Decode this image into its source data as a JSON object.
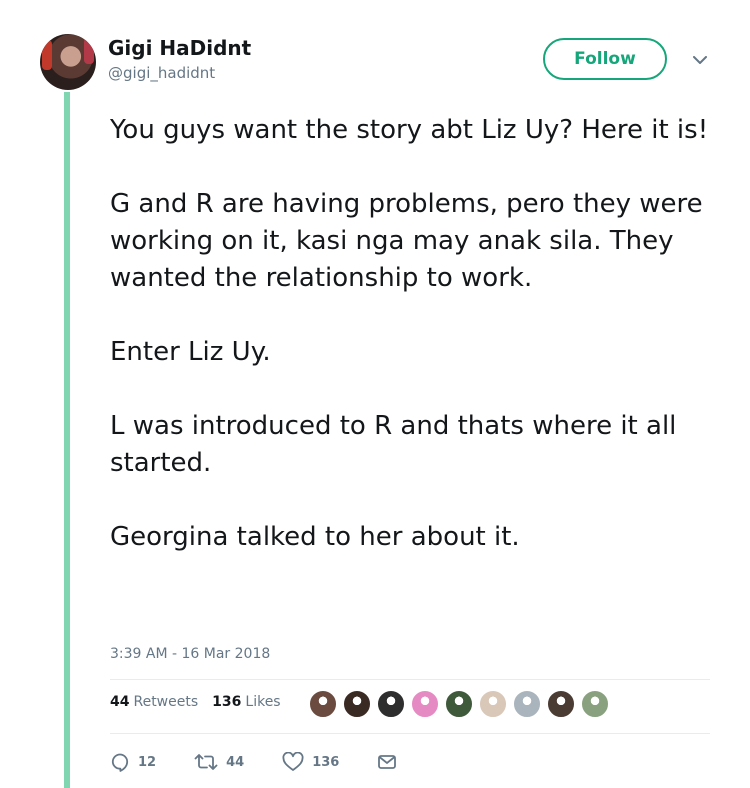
{
  "author": {
    "display_name": "Gigi HaDidnt",
    "handle": "@gigi_hadidnt",
    "avatar": "avatar-photo"
  },
  "follow_button": {
    "label": "Follow",
    "color": "#16a67a"
  },
  "menu": {
    "icon": "chevron-down-icon"
  },
  "tweet": {
    "paragraphs": [
      "You guys want the story abt Liz Uy? Here it is!",
      "G and R are having problems, pero they were working on it, kasi nga may anak sila. They wanted the relationship to work.",
      "Enter Liz Uy.",
      "L was introduced to R and thats where it all started.",
      "Georgina talked to her about it."
    ],
    "timestamp": "3:39 AM - 16 Mar 2018"
  },
  "stats": {
    "retweets_count": "44",
    "retweets_label": "Retweets",
    "likes_count": "136",
    "likes_label": "Likes"
  },
  "likers": [
    {
      "color": "#6b4a3f"
    },
    {
      "color": "#3a2a24"
    },
    {
      "color": "#2e2e2e"
    },
    {
      "color": "#e58ac2"
    },
    {
      "color": "#3f5a3a"
    },
    {
      "color": "#d9c7b8"
    },
    {
      "color": "#a9b4bd"
    },
    {
      "color": "#4a3b33"
    },
    {
      "color": "#8aa17f"
    }
  ],
  "actions": {
    "reply_count": "12",
    "retweet_count": "44",
    "like_count": "136"
  },
  "colors": {
    "thread_line": "#7fd6b1",
    "text": "#14171a",
    "muted": "#657786"
  }
}
